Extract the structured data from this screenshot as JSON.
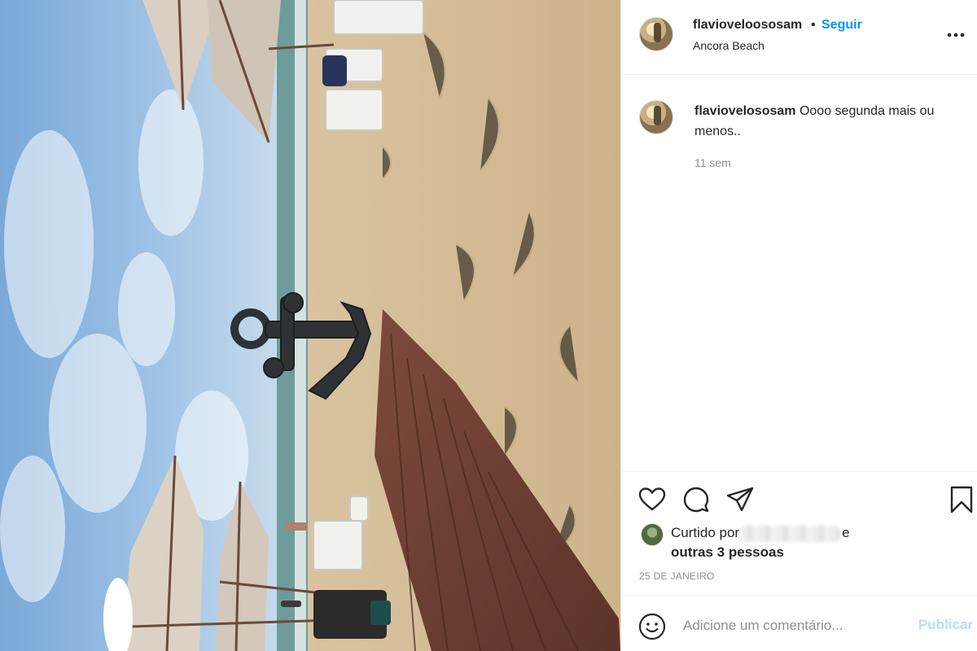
{
  "post": {
    "username": "flavioveloososam",
    "follow_label": "Seguir",
    "separator": "•",
    "location": "Ancora Beach",
    "photo_description_icon": "photo"
  },
  "caption": {
    "username": "flaviovelososam",
    "text": "Oooo segunda mais ou menos..",
    "time": "11 sem"
  },
  "likes": {
    "prefix": "Curtido por",
    "suffix": "e",
    "others": "outras 3 pessoas"
  },
  "date": "25 DE JANEIRO",
  "comment_box": {
    "placeholder": "Adicione um comentário...",
    "publish_label": "Publicar"
  },
  "colors": {
    "link_blue": "#0095f6",
    "publish_disabled": "#b2dffc",
    "secondary_text": "#8e8e8e",
    "divider": "#efefef"
  },
  "icons": [
    "more-options-icon",
    "heart-icon",
    "comment-icon",
    "share-icon",
    "bookmark-icon",
    "emoji-icon"
  ]
}
